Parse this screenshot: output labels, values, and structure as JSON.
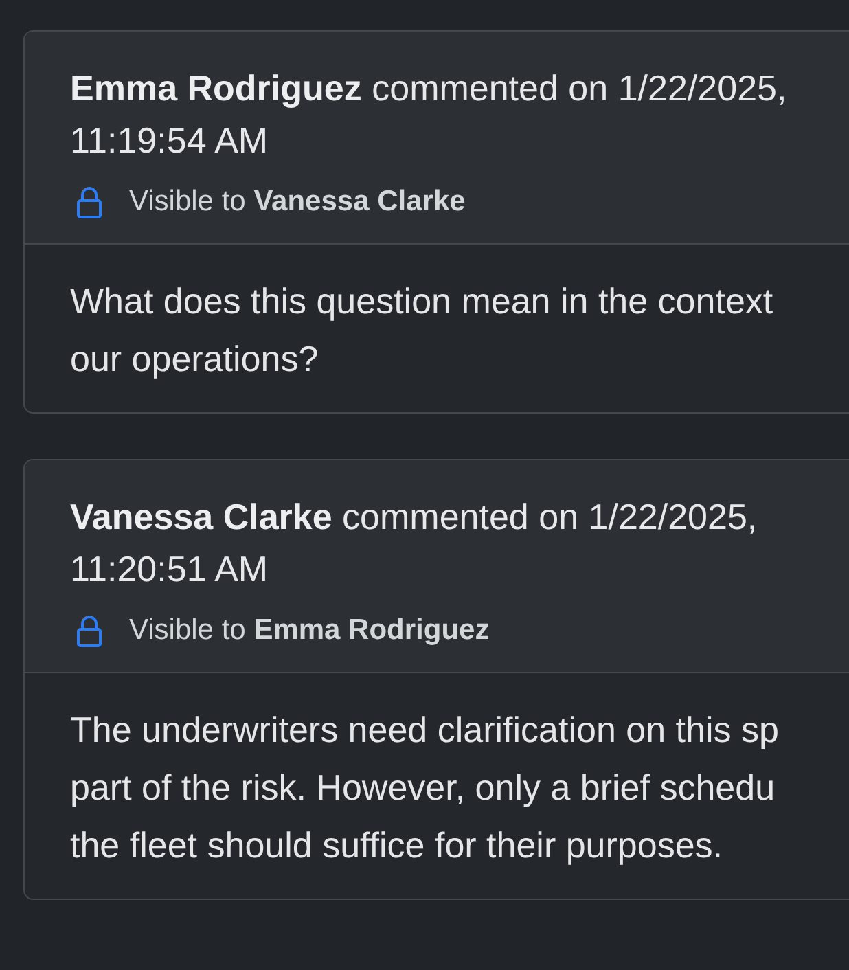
{
  "comments": [
    {
      "author": "Emma Rodriguez",
      "action": "commented on 1/22/2025,",
      "time": "11:19:54 AM",
      "visibility_label": "Visible to",
      "visible_to": "Vanessa Clarke",
      "body_lines": [
        "What does this question mean in the context",
        "our operations?"
      ]
    },
    {
      "author": "Vanessa Clarke",
      "action": "commented on 1/22/2025,",
      "time": "11:20:51 AM",
      "visibility_label": "Visible to",
      "visible_to": "Emma Rodriguez",
      "body_lines": [
        "The underwriters need clarification on this sp",
        "part of the risk. However, only a brief schedu",
        "the fleet should suffice for their purposes."
      ]
    }
  ]
}
